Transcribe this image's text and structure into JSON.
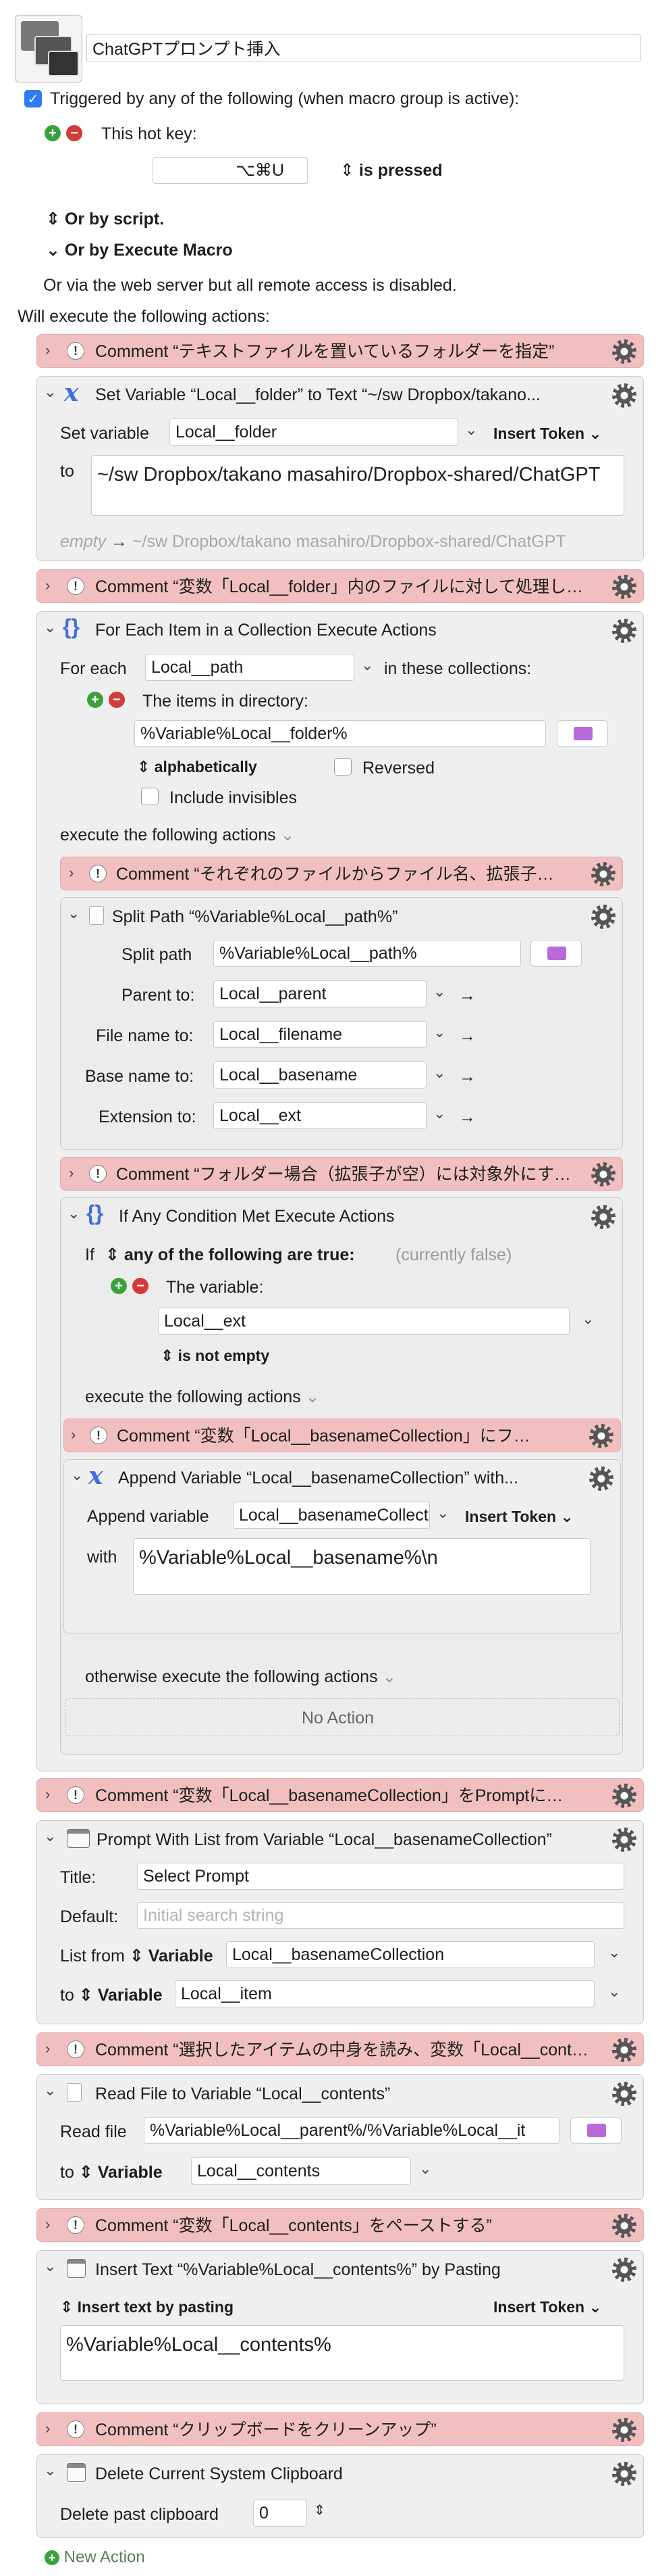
{
  "macro": {
    "name": "ChatGPTプロンプト挿入",
    "trigger_text": "Triggered by any of the following (when macro group is active):",
    "hotkey_label": "This hot key:",
    "hotkey_value": "⌥⌘U",
    "hotkey_state": "is pressed",
    "or_script": "Or by script.",
    "or_execute": "Or by Execute Macro",
    "web_server_note": "Or via the web server but all remote access is disabled.",
    "will_execute": "Will execute the following actions:",
    "new_action": "New Action"
  },
  "common": {
    "insert_token": "Insert Token",
    "execute_following": "execute the following actions",
    "otherwise_following": "otherwise execute the following actions",
    "no_action": "No Action",
    "to_variable": "Variable",
    "to": "to"
  },
  "actions": {
    "c1": "Comment “テキストファイルを置いているフォルダーを指定”",
    "setvar_title": "Set Variable “Local__folder” to Text “~/sw Dropbox/takano...",
    "setvar_label": "Set variable",
    "setvar_name": "Local__folder",
    "setvar_to": "to",
    "setvar_text": "~/sw Dropbox/takano masahiro/Dropbox-shared/ChatGPT",
    "setvar_preview_empty": "empty",
    "setvar_preview_value": "~/sw Dropbox/takano masahiro/Dropbox-shared/ChatGPT",
    "c2": "Comment “変数「Local__folder」内のファイルに対して処理し…",
    "foreach_title": "For Each Item in a Collection Execute Actions",
    "foreach_label": "For each",
    "foreach_var": "Local__path",
    "foreach_in": "in these collections:",
    "items_in_dir": "The items in directory:",
    "dir_value": "%Variable%Local__folder%",
    "sort_order": "alphabetically",
    "reversed": "Reversed",
    "include_invisibles": "Include invisibles",
    "c3": "Comment “それぞれのファイルからファイル名、拡張子…",
    "split_title": "Split Path “%Variable%Local__path%”",
    "split_label": "Split path",
    "split_value": "%Variable%Local__path%",
    "parent_label": "Parent to:",
    "parent_value": "Local__parent",
    "filename_label": "File name to:",
    "filename_value": "Local__filename",
    "basename_label": "Base name to:",
    "basename_value": "Local__basename",
    "ext_label": "Extension to:",
    "ext_value": "Local__ext",
    "c4": "Comment “フォルダー場合（拡張子が空）には対象外にす…",
    "if_title": "If Any Condition Met Execute Actions",
    "if_label": "If",
    "if_cond": "any of the following are true:",
    "if_state": "(currently false)",
    "the_variable": "The variable:",
    "cond_var": "Local__ext",
    "cond_op": "is not empty",
    "c5": "Comment “変数「Local__basenameCollection」にフ…",
    "append_title": "Append Variable “Local__basenameCollection” with...",
    "append_label": "Append variable",
    "append_var": "Local__basenameCollection",
    "append_with": "with",
    "append_value": "%Variable%Local__basename%\\n",
    "c6": "Comment “変数「Local__basenameCollection」をPromptに…",
    "prompt_title": "Prompt With List from Variable “Local__basenameCollection”",
    "prompt_title_label": "Title:",
    "prompt_title_value": "Select Prompt",
    "prompt_default_label": "Default:",
    "prompt_default_ph": "Initial search string",
    "prompt_list_label": "List from",
    "prompt_list_var": "Local__basenameCollection",
    "prompt_to_var": "Local__item",
    "c7": "Comment “選択したアイテムの中身を読み、変数「Local__cont…",
    "read_title": "Read File to Variable “Local__contents”",
    "read_label": "Read file",
    "read_value": "%Variable%Local__parent%/%Variable%Local__it",
    "read_to_var": "Local__contents",
    "c8": "Comment “変数「Local__contents」をペーストする”",
    "insert_title": "Insert Text “%Variable%Local__contents%” by Pasting",
    "insert_mode": "Insert text by pasting",
    "insert_value": "%Variable%Local__contents%",
    "c9": "Comment “クリップボードをクリーンアップ”",
    "delete_title": "Delete Current System Clipboard",
    "delete_label": "Delete past clipboard",
    "delete_value": "0"
  }
}
